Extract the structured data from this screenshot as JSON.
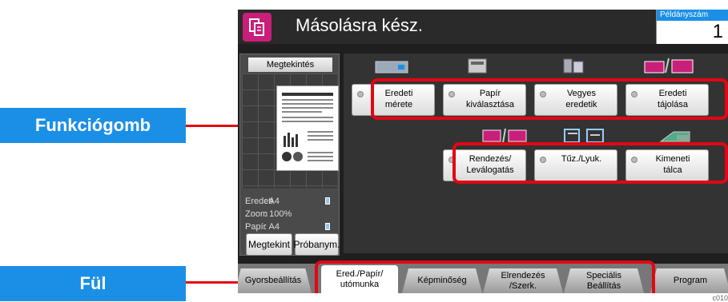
{
  "callouts": {
    "function_key": "Funkciógomb",
    "tab": "Fül"
  },
  "header": {
    "status": "Másolásra kész.",
    "copies_label": "Példányszám",
    "copies_value": "1"
  },
  "preview": {
    "title": "Megtekintés",
    "rows": [
      {
        "key": "Eredeti",
        "value": ": A4"
      },
      {
        "key": "Zoom",
        "value": ": 100%"
      },
      {
        "key": "Papír",
        "value": ": A4"
      }
    ],
    "buttons": {
      "preview": "Megtekint",
      "trial": "Próbanym."
    }
  },
  "functions": {
    "row1": [
      {
        "line1": "Eredeti",
        "line2": "mérete"
      },
      {
        "line1": "Papír",
        "line2": "kiválasztása"
      },
      {
        "line1": "Vegyes",
        "line2": "eredetik"
      },
      {
        "line1": "Eredeti",
        "line2": "tájolása"
      }
    ],
    "row2": [
      {
        "line1": "Rendezés/",
        "line2": "Leválogatás"
      },
      {
        "line1": "Tűz./Lyuk.",
        "line2": ""
      },
      {
        "line1": "Kimeneti",
        "line2": "tálca"
      }
    ]
  },
  "tabs": [
    {
      "line1": "Gyorsbeállítás",
      "line2": ""
    },
    {
      "line1": "Ered./Papír/",
      "line2": "utómunka"
    },
    {
      "line1": "Képminőség",
      "line2": ""
    },
    {
      "line1": "Elrendezés",
      "line2": "/Szerk."
    },
    {
      "line1": "Speciális",
      "line2": "Beállítás"
    },
    {
      "line1": "Program",
      "line2": ""
    }
  ],
  "footer_code": "c010",
  "colors": {
    "accent": "#1b8fe6",
    "highlight": "#e30613",
    "copy_icon": "#c91f7a"
  }
}
